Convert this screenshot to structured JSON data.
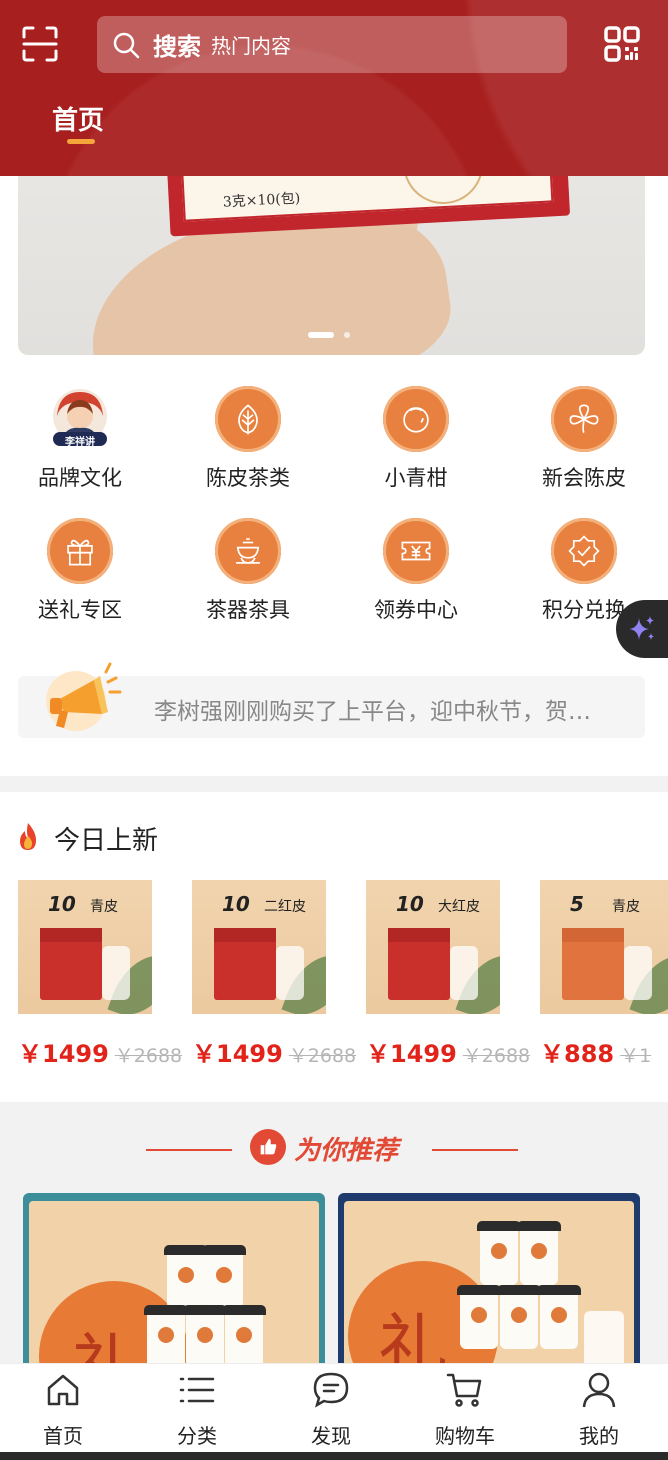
{
  "header": {
    "search_label": "搜索",
    "search_placeholder": "热门内容",
    "active_tab": "首页"
  },
  "banner": {
    "box_text": "3克×10(包)"
  },
  "categories": [
    {
      "label": "品牌文化",
      "icon": "brand-logo-icon"
    },
    {
      "label": "陈皮茶类",
      "icon": "leaf-icon"
    },
    {
      "label": "小青柑",
      "icon": "citrus-icon"
    },
    {
      "label": "新会陈皮",
      "icon": "peel-icon"
    },
    {
      "label": "送礼专区",
      "icon": "gift-icon"
    },
    {
      "label": "茶器茶具",
      "icon": "teapot-icon"
    },
    {
      "label": "领券中心",
      "icon": "coupon-icon"
    },
    {
      "label": "积分兑换",
      "icon": "points-badge-icon"
    }
  ],
  "brand_logo_text": "李祥讲",
  "notice": {
    "text": "李树强刚刚购买了上平台，迎中秋节，贺…"
  },
  "new_today": {
    "title": "今日上新",
    "products": [
      {
        "num": "10",
        "name": "青皮",
        "price": "￥1499",
        "old_price": "￥2688"
      },
      {
        "num": "10",
        "name": "二红皮",
        "price": "￥1499",
        "old_price": "￥2688"
      },
      {
        "num": "10",
        "name": "大红皮",
        "price": "￥1499",
        "old_price": "￥2688"
      },
      {
        "num": "5",
        "name": "青皮",
        "price": "￥888",
        "old_price": "￥1"
      }
    ]
  },
  "recommend": {
    "title": "为你推荐",
    "tin_char": "礼"
  },
  "tabbar": [
    {
      "label": "首页",
      "icon": "home-icon"
    },
    {
      "label": "分类",
      "icon": "list-icon"
    },
    {
      "label": "发现",
      "icon": "chat-bubble-icon"
    },
    {
      "label": "购物车",
      "icon": "cart-icon"
    },
    {
      "label": "我的",
      "icon": "user-icon"
    }
  ],
  "colors": {
    "header_red": "#a81f1f",
    "accent_orange": "#e8813f",
    "price_red": "#e2231a",
    "recommend_red": "#e24a35"
  }
}
